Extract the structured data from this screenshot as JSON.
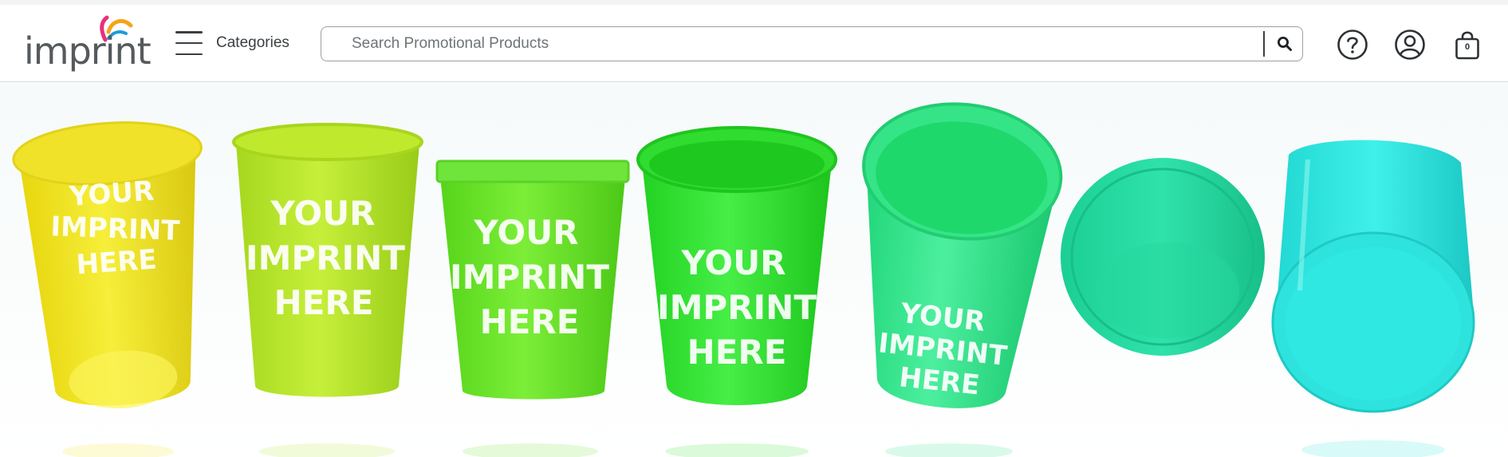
{
  "header": {
    "logo_text": "imprint",
    "menu_label": "Categories",
    "search": {
      "placeholder": "Search Promotional Products"
    },
    "icons": {
      "help": "help-icon",
      "account": "account-icon",
      "cart": "cart-icon"
    },
    "cart_count": "0"
  },
  "hero": {
    "cup_imprint_lines": [
      "YOUR",
      "IMPRINT",
      "HERE"
    ],
    "cup_colors": [
      "#f2e51a",
      "#b8e82a",
      "#6be62a",
      "#33e633",
      "#2ee58a",
      "#21dda0",
      "#29e5de"
    ]
  },
  "colors": {
    "text": "#3a3f42",
    "border": "#9aa0a3",
    "logo_arc_1": "#e8307a",
    "logo_arc_2": "#f7a21b",
    "logo_arc_3": "#1e9bd7"
  }
}
